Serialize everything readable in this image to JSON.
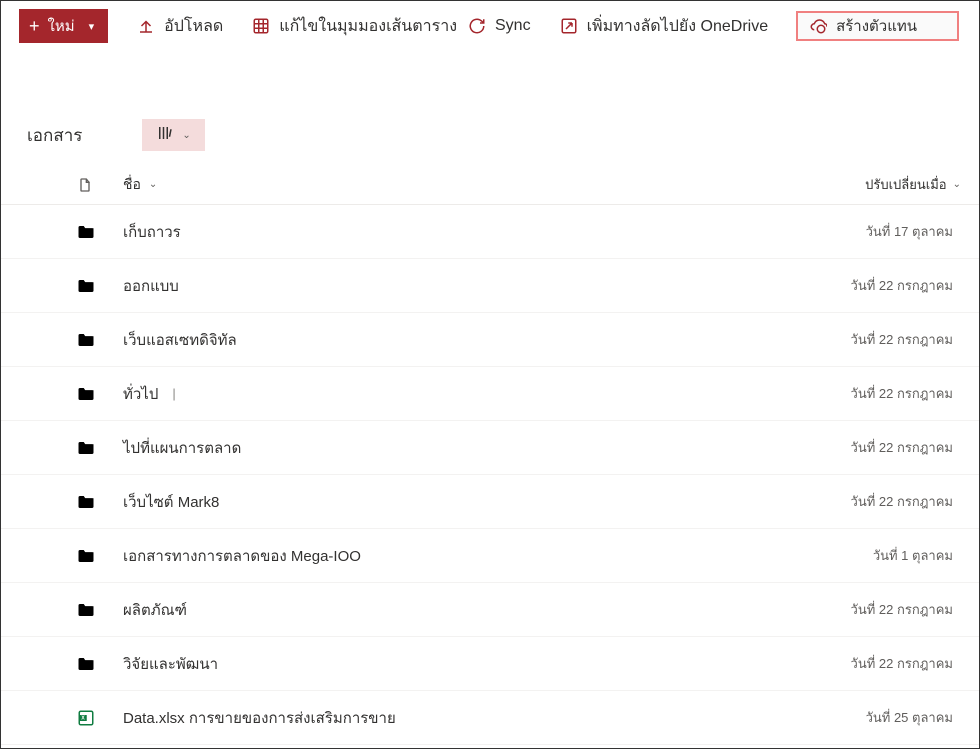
{
  "toolbar": {
    "new_label": "ใหม่",
    "upload_label": "อัปโหลด",
    "grid_label": "แก้ไขในมุมมองเส้นตาราง",
    "sync_label": "Sync",
    "shortcut_label": "เพิ่มทางลัดไปยัง OneDrive",
    "agent_label": "สร้างตัวแทน"
  },
  "library": {
    "title": "เอกสาร"
  },
  "columns": {
    "name": "ชื่อ",
    "modified": "ปรับเปลี่ยนเมื่อ"
  },
  "rows": [
    {
      "type": "folder-gray",
      "name": "เก็บถาวร",
      "modified": "วันที่ 17 ตุลาคม"
    },
    {
      "type": "folder-yellow",
      "name": "ออกแบบ",
      "modified": "วันที่ 22 กรกฎาคม"
    },
    {
      "type": "folder-yellow",
      "name": "เว็บแอสเซทดิจิทัล",
      "modified": "วันที่ 22 กรกฎาคม"
    },
    {
      "type": "folder-yellow",
      "name": "ทั่วไป",
      "modified": "วันที่ 22 กรกฎาคม",
      "cursor": true
    },
    {
      "type": "folder-yellow",
      "name": "ไปที่แผนการตลาด",
      "modified": "วันที่ 22 กรกฎาคม"
    },
    {
      "type": "folder-yellow",
      "name": "เว็บไซต์ Mark8",
      "modified": "วันที่ 22 กรกฎาคม"
    },
    {
      "type": "folder-magenta",
      "name": "เอกสารทางการตลาดของ Mega-IOO",
      "modified": "วันที่ 1 ตุลาคม"
    },
    {
      "type": "folder-yellow",
      "name": "ผลิตภัณฑ์",
      "modified": "วันที่ 22 กรกฎาคม"
    },
    {
      "type": "folder-yellow",
      "name": "วิจัยและพัฒนา",
      "modified": "วันที่ 22 กรกฎาคม"
    },
    {
      "type": "file-xlsx",
      "name": "Data.xlsx การขายของการส่งเสริมการขาย",
      "modified": "วันที่ 25 ตุลาคม"
    }
  ]
}
